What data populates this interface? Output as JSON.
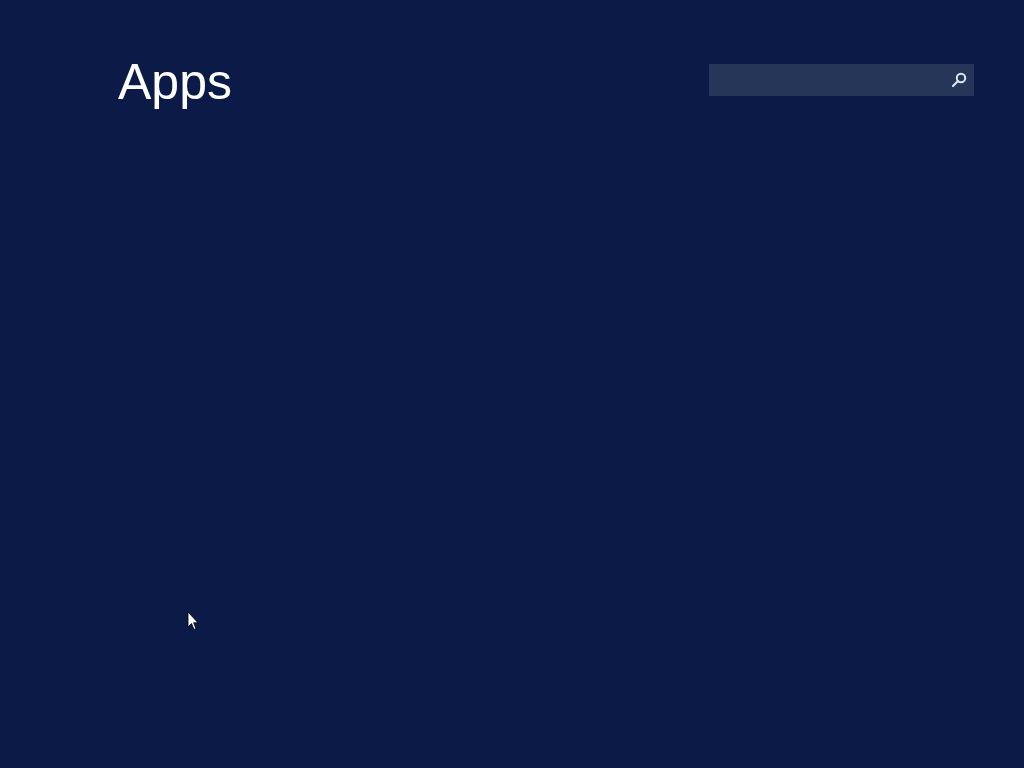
{
  "title": "Apps"
}
